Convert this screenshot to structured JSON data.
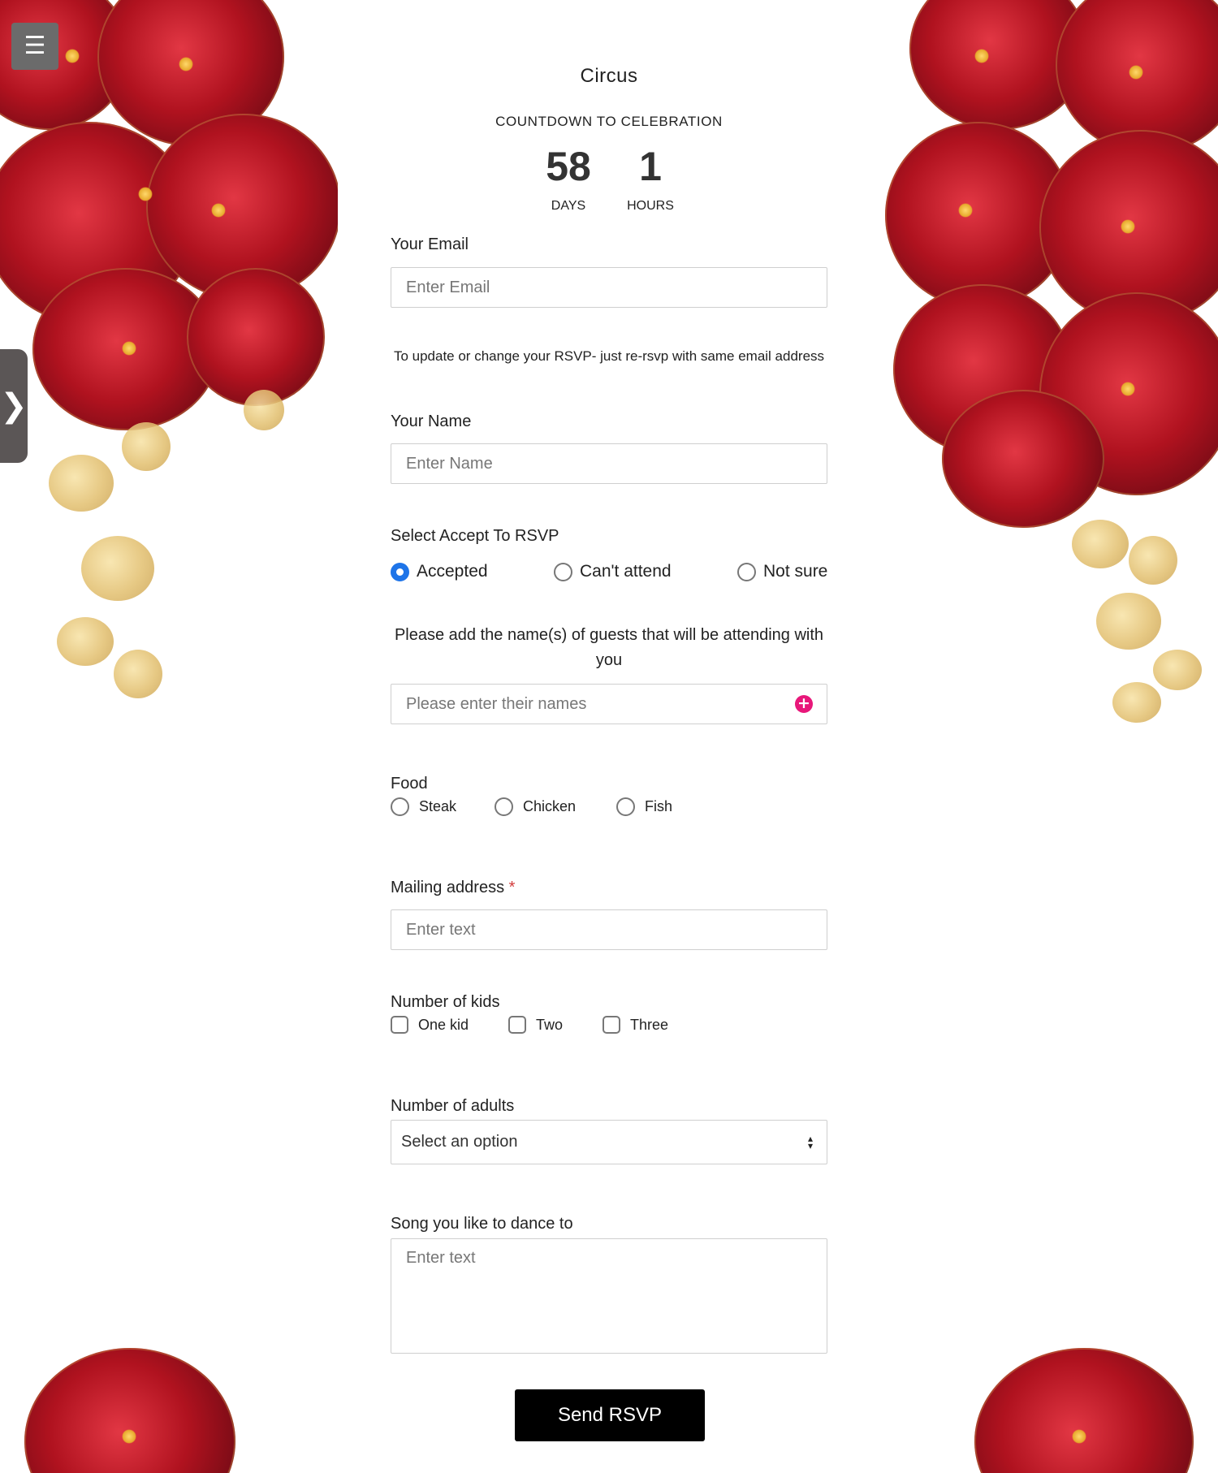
{
  "event": {
    "title": "Circus",
    "countdown_label": "COUNTDOWN TO CELEBRATION",
    "days_value": "58",
    "days_label": "DAYS",
    "hours_value": "1",
    "hours_label": "HOURS"
  },
  "form": {
    "email": {
      "label": "Your Email",
      "placeholder": "Enter Email",
      "help": "To update or change your RSVP- just re-rsvp with same email address"
    },
    "name": {
      "label": "Your Name",
      "placeholder": "Enter Name"
    },
    "rsvp": {
      "label": "Select Accept To RSVP",
      "options": [
        "Accepted",
        "Can't attend",
        "Not sure"
      ],
      "selected": "Accepted"
    },
    "guests": {
      "label": "Please add the name(s) of guests that will be attending with you",
      "placeholder": "Please enter their names",
      "add_icon": "plus-circle-icon"
    },
    "food": {
      "label": "Food",
      "options": [
        "Steak",
        "Chicken",
        "Fish"
      ]
    },
    "mailing": {
      "label": "Mailing address",
      "required_mark": "*",
      "placeholder": "Enter text"
    },
    "kids": {
      "label": "Number of kids",
      "options": [
        "One kid",
        "Two",
        "Three"
      ]
    },
    "adults": {
      "label": "Number of adults",
      "selected_value": "Select an option"
    },
    "song": {
      "label": "Song you like to dance to",
      "placeholder": "Enter text"
    },
    "submit_label": "Send RSVP"
  },
  "chrome": {
    "menu_icon": "hamburger-menu-icon",
    "side_tab_icon": "chevron-right-icon"
  },
  "colors": {
    "radio_selected": "#1e74e8",
    "add_icon": "#e8177a",
    "button": "#000000",
    "required": "#d23b3b"
  }
}
